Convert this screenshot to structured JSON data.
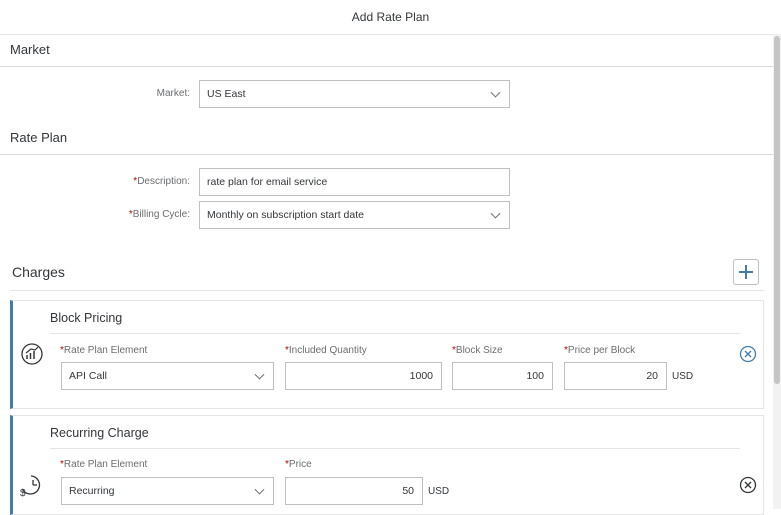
{
  "window": {
    "title": "Add Rate Plan"
  },
  "market_section": {
    "title": "Market",
    "market_label": "Market:",
    "market_value": "US East"
  },
  "rate_plan_section": {
    "title": "Rate Plan",
    "description_label": "Description:",
    "description_value": "rate plan for email service",
    "billing_label": "Billing Cycle:",
    "billing_value": "Monthly on subscription start date"
  },
  "charges_section": {
    "title": "Charges",
    "add_icon": "plus-icon"
  },
  "block_pricing": {
    "title": "Block Pricing",
    "icon": "chart-circle-icon",
    "element_label": "Rate Plan Element",
    "element_value": "API Call",
    "included_label": "Included Quantity",
    "included_value": "1000",
    "block_size_label": "Block Size",
    "block_size_value": "100",
    "price_label": "Price per Block",
    "price_value": "20",
    "currency": "USD"
  },
  "recurring_charge": {
    "title": "Recurring Charge",
    "icon": "dollar-clock-icon",
    "element_label": "Rate Plan Element",
    "element_value": "Recurring",
    "price_label": "Price",
    "price_value": "50",
    "currency": "USD"
  },
  "colors": {
    "accent": "#427cac",
    "required": "#bb0000"
  }
}
